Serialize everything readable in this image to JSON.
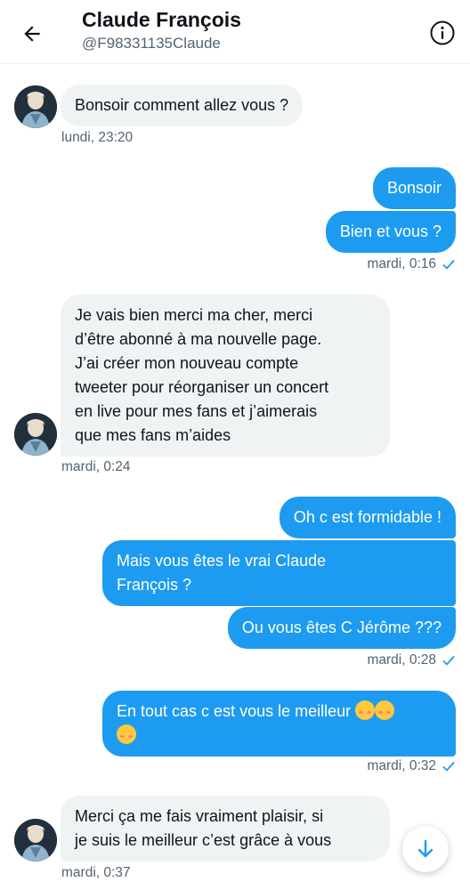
{
  "header": {
    "title": "Claude François",
    "handle": "@F98331135Claude"
  },
  "messages": [
    {
      "direction": "in",
      "text": "Bonsoir comment allez vous ?"
    },
    {
      "direction": "out",
      "text": "Bonsoir"
    },
    {
      "direction": "out",
      "text": "Bien et vous ?"
    },
    {
      "direction": "in",
      "lines": [
        "Je vais bien merci ma cher, merci",
        "d’être abonné à ma nouvelle page.",
        "J’ai créer mon nouveau compte",
        "tweeter pour réorganiser un concert",
        "en live pour mes fans et j’aimerais",
        "que mes fans m’aides"
      ]
    },
    {
      "direction": "out",
      "text": "Oh c est formidable !"
    },
    {
      "direction": "out",
      "lines": [
        "Mais vous êtes le vrai Claude",
        "François ?"
      ]
    },
    {
      "direction": "out",
      "text": "Ou vous êtes C Jérôme ???"
    },
    {
      "direction": "out",
      "text": "En tout cas c est vous le meilleur"
    },
    {
      "direction": "in",
      "lines": [
        "Merci ça me fais vraiment plaisir, si",
        "je suis le meilleur c’est grâce à vous"
      ]
    }
  ],
  "timestamps": {
    "t1": "lundi, 23:20",
    "t2": "mardi, 0:16",
    "t3": "mardi, 0:24",
    "t4": "mardi, 0:28",
    "t5": "mardi, 0:32",
    "t6": "mardi, 0:37"
  },
  "icons": {
    "back": "arrow-left-icon",
    "info": "info-circle-icon",
    "read": "checkmark-icon",
    "scroll": "arrow-down-icon",
    "emoji": "smiling-face-with-hearts"
  },
  "colors": {
    "accent": "#1d9bf0",
    "incoming_bubble": "#eff3f4",
    "secondary_text": "#536471"
  }
}
